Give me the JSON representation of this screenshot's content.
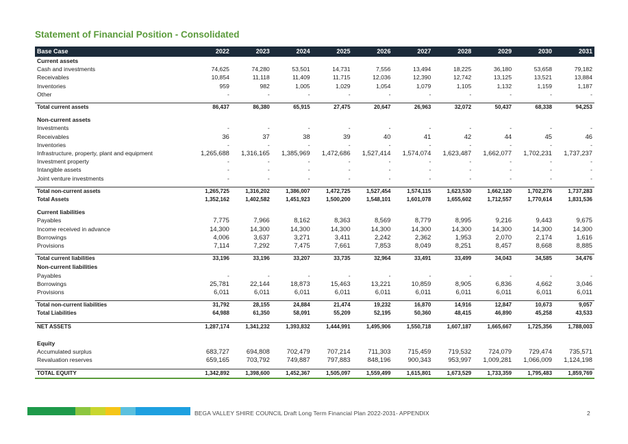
{
  "title": "Statement of Financial Position - Consolidated",
  "header": {
    "label": "Base Case",
    "years": [
      "2022",
      "2023",
      "2024",
      "2025",
      "2026",
      "2027",
      "2028",
      "2029",
      "2030",
      "2031"
    ]
  },
  "rows": [
    {
      "type": "section",
      "label": "Current assets"
    },
    {
      "type": "item",
      "label": "Cash and investments",
      "values": [
        "74,625",
        "74,280",
        "53,501",
        "14,731",
        "7,556",
        "13,494",
        "18,225",
        "36,180",
        "53,658",
        "79,182"
      ]
    },
    {
      "type": "item",
      "label": "Receivables",
      "values": [
        "10,854",
        "11,118",
        "11,409",
        "11,715",
        "12,036",
        "12,390",
        "12,742",
        "13,125",
        "13,521",
        "13,884"
      ]
    },
    {
      "type": "item",
      "label": "Inventories",
      "values": [
        "959",
        "982",
        "1,005",
        "1,029",
        "1,054",
        "1,079",
        "1,105",
        "1,132",
        "1,159",
        "1,187"
      ]
    },
    {
      "type": "item",
      "label": "Other",
      "values": [
        "-",
        "-",
        "-",
        "-",
        "-",
        "-",
        "-",
        "-",
        "-",
        "-"
      ]
    },
    {
      "type": "spacer"
    },
    {
      "type": "total",
      "label": "Total current assets",
      "values": [
        "86,437",
        "86,380",
        "65,915",
        "27,475",
        "20,647",
        "26,963",
        "32,072",
        "50,437",
        "68,338",
        "94,253"
      ]
    },
    {
      "type": "spacer"
    },
    {
      "type": "section",
      "label": "Non-current assets"
    },
    {
      "type": "item",
      "label": "Investments",
      "values": [
        "-",
        "-",
        "-",
        "-",
        "-",
        "-",
        "-",
        "-",
        "-",
        "-"
      ]
    },
    {
      "type": "item",
      "big": true,
      "label": "Receivables",
      "values": [
        "36",
        "37",
        "38",
        "39",
        "40",
        "41",
        "42",
        "44",
        "45",
        "46"
      ]
    },
    {
      "type": "item",
      "label": "Inventories",
      "values": [
        "-",
        "-",
        "-",
        "-",
        "-",
        "-",
        "-",
        "-",
        "-",
        "-"
      ]
    },
    {
      "type": "item",
      "big": true,
      "label": "Infrastructure, property, plant and equipment",
      "values": [
        "1,265,688",
        "1,316,165",
        "1,385,969",
        "1,472,686",
        "1,527,414",
        "1,574,074",
        "1,623,487",
        "1,662,077",
        "1,702,231",
        "1,737,237"
      ]
    },
    {
      "type": "item",
      "label": "Investment property",
      "values": [
        "-",
        "-",
        "-",
        "-",
        "-",
        "-",
        "-",
        "-",
        "-",
        "-"
      ]
    },
    {
      "type": "item",
      "label": "Intangible assets",
      "values": [
        "-",
        "-",
        "-",
        "-",
        "-",
        "-",
        "-",
        "-",
        "-",
        "-"
      ]
    },
    {
      "type": "item",
      "label": "Joint venture investments",
      "values": [
        "-",
        "-",
        "-",
        "-",
        "-",
        "-",
        "-",
        "-",
        "-",
        "-"
      ]
    },
    {
      "type": "spacer"
    },
    {
      "type": "total",
      "label": "Total non-current assets",
      "values": [
        "1,265,725",
        "1,316,202",
        "1,386,007",
        "1,472,725",
        "1,527,454",
        "1,574,115",
        "1,623,530",
        "1,662,120",
        "1,702,276",
        "1,737,283"
      ]
    },
    {
      "type": "total",
      "label": "Total Assets",
      "values": [
        "1,352,162",
        "1,402,582",
        "1,451,923",
        "1,500,200",
        "1,548,101",
        "1,601,078",
        "1,655,602",
        "1,712,557",
        "1,770,614",
        "1,831,536"
      ]
    },
    {
      "type": "spacer"
    },
    {
      "type": "section",
      "label": "Current liabilities"
    },
    {
      "type": "item",
      "big": true,
      "label": "Payables",
      "values": [
        "7,775",
        "7,966",
        "8,162",
        "8,363",
        "8,569",
        "8,779",
        "8,995",
        "9,216",
        "9,443",
        "9,675"
      ]
    },
    {
      "type": "item",
      "big": true,
      "label": "Income received in advance",
      "values": [
        "14,300",
        "14,300",
        "14,300",
        "14,300",
        "14,300",
        "14,300",
        "14,300",
        "14,300",
        "14,300",
        "14,300"
      ]
    },
    {
      "type": "item",
      "big": true,
      "label": "Borrowings",
      "values": [
        "4,006",
        "3,637",
        "3,271",
        "3,411",
        "2,242",
        "2,362",
        "1,953",
        "2,070",
        "2,174",
        "1,616"
      ]
    },
    {
      "type": "item",
      "big": true,
      "label": "Provisions",
      "values": [
        "7,114",
        "7,292",
        "7,475",
        "7,661",
        "7,853",
        "8,049",
        "8,251",
        "8,457",
        "8,668",
        "8,885"
      ]
    },
    {
      "type": "spacer"
    },
    {
      "type": "total",
      "label": "Total current liabilities",
      "values": [
        "33,196",
        "33,196",
        "33,207",
        "33,735",
        "32,964",
        "33,491",
        "33,499",
        "34,043",
        "34,585",
        "34,476"
      ]
    },
    {
      "type": "section",
      "label": "Non-current liabilities"
    },
    {
      "type": "item",
      "label": "Payables",
      "values": [
        "-",
        "-",
        "-",
        "-",
        "-",
        "-",
        "-",
        "-",
        "-",
        "-"
      ]
    },
    {
      "type": "item",
      "big": true,
      "label": "Borrowings",
      "values": [
        "25,781",
        "22,144",
        "18,873",
        "15,463",
        "13,221",
        "10,859",
        "8,905",
        "6,836",
        "4,662",
        "3,046"
      ]
    },
    {
      "type": "item",
      "big": true,
      "label": "Provisions",
      "values": [
        "6,011",
        "6,011",
        "6,011",
        "6,011",
        "6,011",
        "6,011",
        "6,011",
        "6,011",
        "6,011",
        "6,011"
      ]
    },
    {
      "type": "spacer"
    },
    {
      "type": "total",
      "label": "Total non-current liabilities",
      "values": [
        "31,792",
        "28,155",
        "24,884",
        "21,474",
        "19,232",
        "16,870",
        "14,916",
        "12,847",
        "10,673",
        "9,057"
      ]
    },
    {
      "type": "total",
      "label": "Total Liabilities",
      "values": [
        "64,988",
        "61,350",
        "58,091",
        "55,209",
        "52,195",
        "50,360",
        "48,415",
        "46,890",
        "45,258",
        "43,533"
      ]
    },
    {
      "type": "spacer"
    },
    {
      "type": "total",
      "label": "NET ASSETS",
      "values": [
        "1,287,174",
        "1,341,232",
        "1,393,832",
        "1,444,991",
        "1,495,906",
        "1,550,718",
        "1,607,187",
        "1,665,667",
        "1,725,356",
        "1,788,003"
      ]
    },
    {
      "type": "spacer"
    },
    {
      "type": "spacer"
    },
    {
      "type": "section",
      "label": "Equity"
    },
    {
      "type": "item",
      "big": true,
      "label": "Accumulated surplus",
      "values": [
        "683,727",
        "694,808",
        "702,479",
        "707,214",
        "711,303",
        "715,459",
        "719,532",
        "724,079",
        "729,474",
        "735,571"
      ]
    },
    {
      "type": "item",
      "big": true,
      "label": "Revaluation reserves",
      "values": [
        "659,165",
        "703,792",
        "749,887",
        "797,883",
        "848,196",
        "900,343",
        "953,997",
        "1,009,281",
        "1,066,009",
        "1,124,198"
      ]
    },
    {
      "type": "spacer"
    },
    {
      "type": "final",
      "label": "TOTAL EQUITY",
      "values": [
        "1,342,892",
        "1,398,600",
        "1,452,367",
        "1,505,097",
        "1,559,499",
        "1,615,801",
        "1,673,529",
        "1,733,359",
        "1,795,483",
        "1,859,769"
      ]
    }
  ],
  "footer": {
    "text": "BEGA VALLEY SHIRE COUNCIL  Draft Long Term Financial Plan 2022-2031- APPENDIX",
    "page": "2",
    "bar_colors": [
      "#1e9a4a",
      "#1e9a4a",
      "#8cc63f",
      "#c8d62e",
      "#f5c518",
      "#5bc0de",
      "#1ea0e0"
    ]
  }
}
